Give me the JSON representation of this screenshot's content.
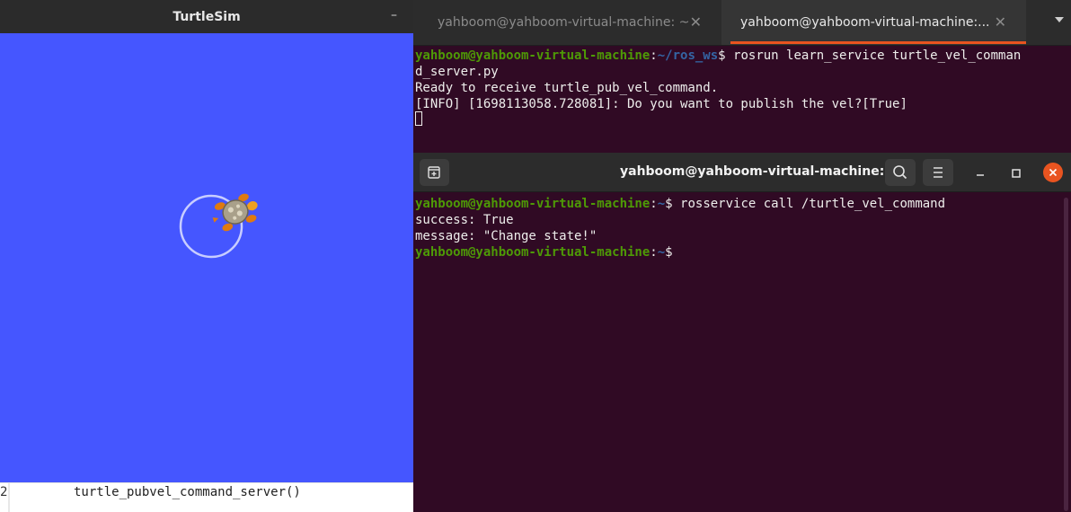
{
  "turtlesim": {
    "title": "TurtleSim",
    "minimize_glyph": "–",
    "background_color": "#4556ff",
    "path_color": "#c8cdff"
  },
  "editor": {
    "line_number": "2",
    "code": "turtle_pubvel_command_server()"
  },
  "back_terminal": {
    "tabs": [
      {
        "label": "yahboom@yahboom-virtual-machine: ~",
        "active": false
      },
      {
        "label": "yahboom@yahboom-virtual-machine:...",
        "active": true
      }
    ],
    "close_glyph": "✕",
    "prompt_user": "yahboom@yahboom-virtual-machine",
    "prompt_colon": ":",
    "prompt_path": "~/ros_ws",
    "command": "$ rosrun learn_service turtle_vel_comman",
    "command_wrap": "d_server.py",
    "output": [
      "Ready to receive turtle_pub_vel_command.",
      "[INFO] [1698113058.728081]: Do you want to publish the vel?[True]"
    ]
  },
  "front_terminal": {
    "title": "yahboom@yahboom-virtual-machine: ~",
    "prompt_user": "yahboom@yahboom-virtual-machine",
    "prompt_colon": ":",
    "prompt_path": "~",
    "command": "$ rosservice call /turtle_vel_command",
    "output": [
      "success: True",
      "message: \"Change state!\""
    ],
    "final_prompt_suffix": "$"
  },
  "icons": {
    "new_tab": "new-tab-icon",
    "search": "search-icon",
    "menu": "hamburger-menu-icon",
    "minimize": "minimize-icon",
    "maximize": "maximize-icon",
    "close": "close-icon"
  },
  "colors": {
    "accent": "#e95420",
    "terminal_bg": "#300a24",
    "prompt_user": "#4e9a06",
    "prompt_path": "#3465a4"
  }
}
